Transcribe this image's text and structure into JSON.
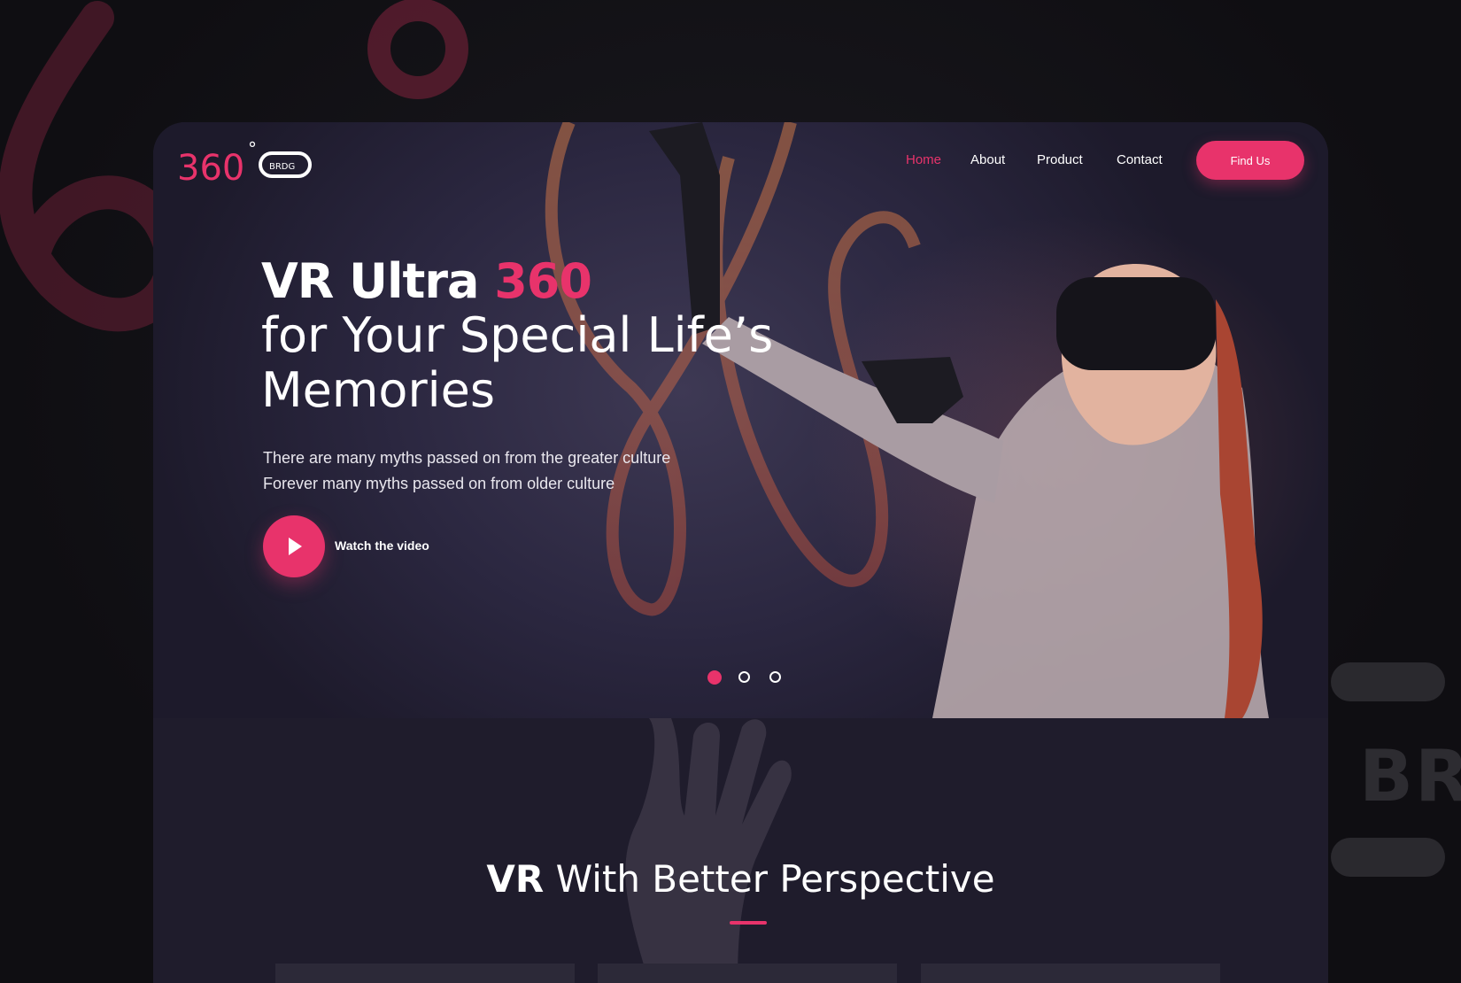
{
  "brand": {
    "logo_number": "360",
    "logo_degree": "°",
    "logo_tag": "BRDG",
    "background_text": "BR"
  },
  "nav": {
    "items": [
      {
        "label": "Home",
        "active": true
      },
      {
        "label": "About",
        "active": false
      },
      {
        "label": "Product",
        "active": false
      },
      {
        "label": "Contact",
        "active": false
      }
    ],
    "cta_label": "Find Us"
  },
  "hero": {
    "title_part1": "VR Ultra",
    "title_accent": "360",
    "title_line2": "for Your Special Life’s",
    "title_line3": "Memories",
    "subtitle_line1": "There are many myths passed on from the greater culture",
    "subtitle_line2": "Forever many myths passed on from older culture",
    "video_label": "Watch the video",
    "slide_count": 3,
    "active_slide": 1
  },
  "section": {
    "title_bold": "VR",
    "title_rest": "With Better Perspective"
  },
  "colors": {
    "accent": "#e8336b",
    "background": "#111013",
    "card": "#1f1c2b"
  },
  "icons": [
    "play-icon",
    "logo-mark"
  ]
}
